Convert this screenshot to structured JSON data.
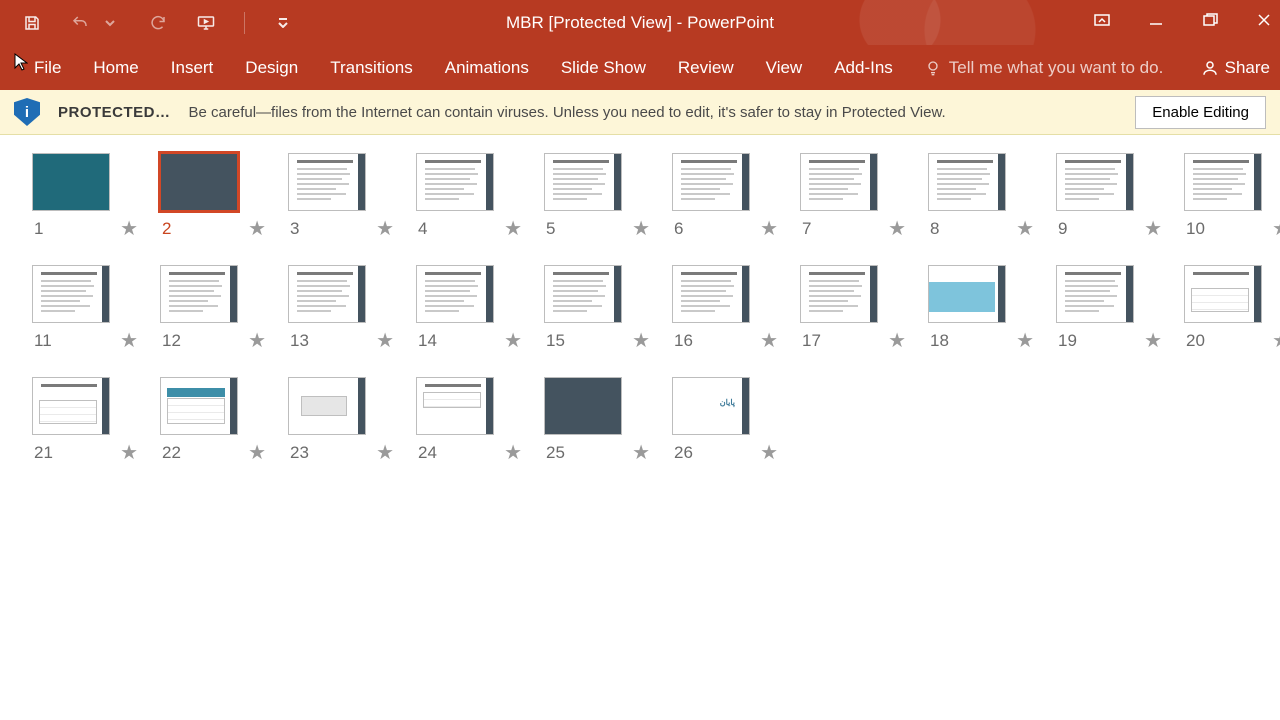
{
  "titlebar": {
    "title": "MBR [Protected View] - PowerPoint"
  },
  "qat": {
    "save": "save-icon",
    "undo": "undo-icon",
    "redo": "redo-icon",
    "present": "start-from-beginning-icon",
    "more": "customize-qat-icon"
  },
  "wincontrols": {
    "opts": "ribbon-display-options-icon",
    "min": "minimize-icon",
    "max": "restore-icon",
    "close": "close-icon"
  },
  "ribbon": {
    "tabs": [
      "File",
      "Home",
      "Insert",
      "Design",
      "Transitions",
      "Animations",
      "Slide Show",
      "Review",
      "View",
      "Add-Ins"
    ],
    "tellme": "Tell me what you want to do.",
    "share": "Share"
  },
  "protected": {
    "label": "PROTECTED…",
    "message": "Be careful—files from the Internet can contain viruses. Unless you need to edit, it's safer to stay in Protected View.",
    "button": "Enable Editing",
    "shield_letter": "i"
  },
  "slides": {
    "count": 26,
    "selected": 2,
    "numbers": [
      "1",
      "2",
      "3",
      "4",
      "5",
      "6",
      "7",
      "8",
      "9",
      "10",
      "11",
      "12",
      "13",
      "14",
      "15",
      "16",
      "17",
      "18",
      "19",
      "20",
      "21",
      "22",
      "23",
      "24",
      "25",
      "26"
    ]
  },
  "extra_text": {
    "slide26": "پایان"
  }
}
